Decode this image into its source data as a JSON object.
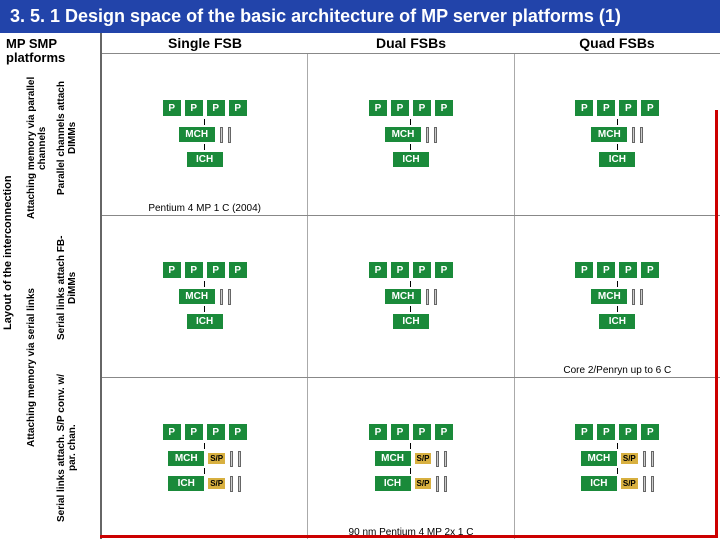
{
  "title": "3. 5. 1 Design space of the basic architecture of MP server platforms (1)",
  "sidebar_label": "MP SMP platforms",
  "axis_labels": {
    "outer_y": "Layout of the interconnection",
    "mid_top": "Attaching memory via parallel channels",
    "mid_bot": "Attaching memory via serial links",
    "inner_r0": "Parallel channels attach DIMMs",
    "inner_r1": "Serial links attach FB-DiMMs",
    "inner_r2": "Serial links attach. S/P conv. w/ par. chan."
  },
  "columns": [
    "Single FSB",
    "Dual FSBs",
    "Quad FSBs"
  ],
  "chip_labels": {
    "p": "P",
    "mch": "MCH",
    "ich": "ICH",
    "sp": "S/P"
  },
  "captions": {
    "row0_col0": "Pentium 4 MP 1 C (2004)",
    "row1_col2": "Core 2/Penryn up to 6 C",
    "row2_col1": "90 nm Pentium 4 MP 2x 1 C"
  }
}
